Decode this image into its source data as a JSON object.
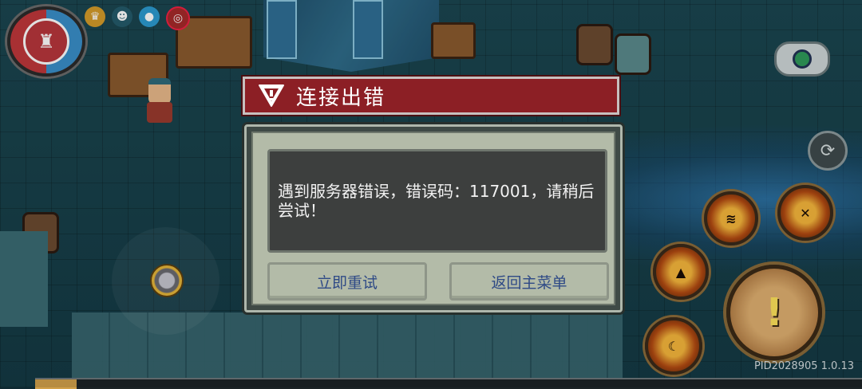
{
  "dialog": {
    "title": "连接出错",
    "message": "遇到服务器错误，错误码：117001，请稍后尝试！",
    "retry_label": "立即重试",
    "menu_label": "返回主菜单"
  },
  "footer": {
    "build_info": "PID2028905 1.0.13"
  },
  "hud": {
    "hp_bar_progress": 0.05,
    "attack_symbol": "!"
  },
  "colors": {
    "title_bar": "#8c1f25",
    "dialog_frame": "#b3bba8",
    "button_text": "#2f4a86"
  }
}
